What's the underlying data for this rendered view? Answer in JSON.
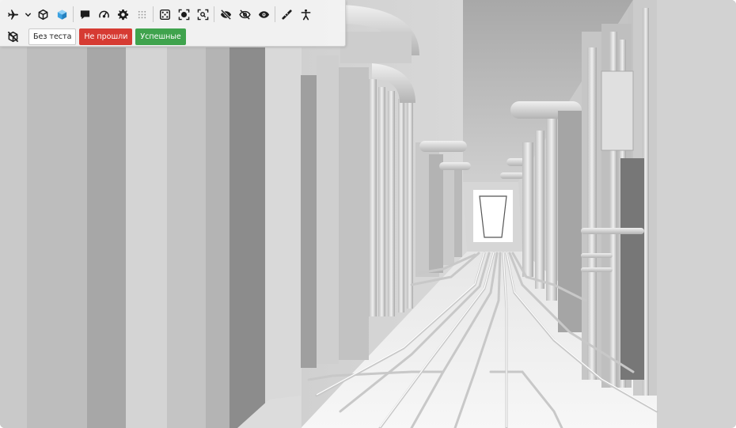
{
  "toolbar": {
    "row1": [
      {
        "icon": "airplane-icon",
        "glyph": "airplane"
      },
      {
        "icon": "chevron-down-icon",
        "glyph": "chevron"
      },
      {
        "icon": "cube-outline-icon",
        "glyph": "cube-outline"
      },
      {
        "icon": "cube-solid-icon",
        "glyph": "cube-solid"
      },
      {
        "icon": "comment-icon",
        "glyph": "comment"
      },
      {
        "icon": "speedometer-icon",
        "glyph": "gauge"
      },
      {
        "icon": "gear-icon",
        "glyph": "gear"
      },
      {
        "icon": "grid-dots-icon",
        "glyph": "grid"
      },
      {
        "icon": "dice-icon",
        "glyph": "dice"
      },
      {
        "icon": "focus-object-icon",
        "glyph": "focus"
      },
      {
        "icon": "zoom-fit-icon",
        "glyph": "fit"
      },
      {
        "icon": "eye-slash-filled-icon",
        "glyph": "eye-slash"
      },
      {
        "icon": "eye-slash-outline-icon",
        "glyph": "eye-slash-outline"
      },
      {
        "icon": "eye-icon",
        "glyph": "eye"
      },
      {
        "icon": "ruler-pencil-icon",
        "glyph": "ruler"
      },
      {
        "icon": "walk-person-icon",
        "glyph": "person"
      }
    ],
    "row2_icon": "hide-cube-icon",
    "filters": {
      "no_test": "Без теста",
      "failed": "Не прошли",
      "passed": "Успешные"
    }
  },
  "colors": {
    "failed": "#d63b33",
    "passed": "#3fa34d",
    "icon": "#1c1c1c",
    "icon_accent": "#3ba0e0",
    "scene_bg": "#d9d9d9"
  }
}
